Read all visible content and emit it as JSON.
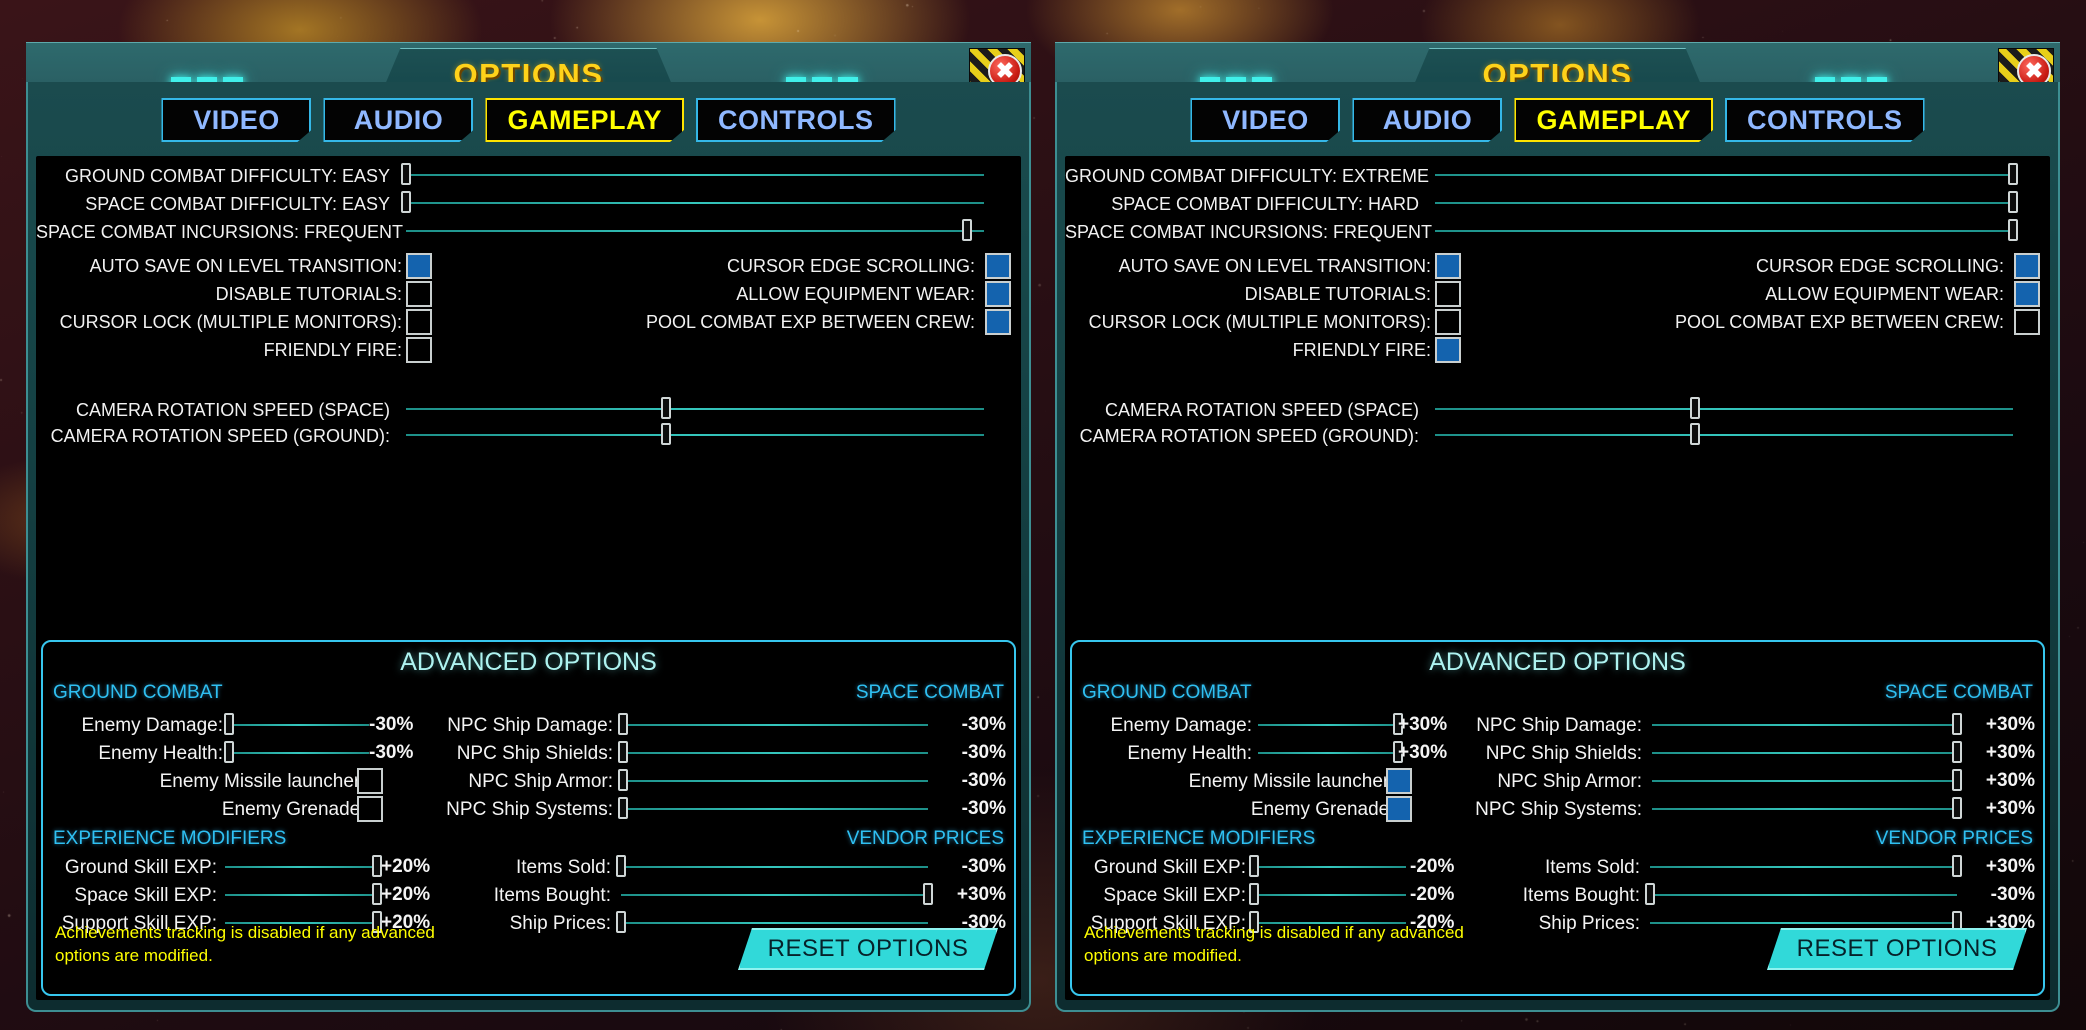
{
  "window": {
    "title": "OPTIONS",
    "close_icon": "close-x-icon",
    "dots_icon": "three-dash-icon"
  },
  "tabs": [
    {
      "label": "VIDEO",
      "active": false
    },
    {
      "label": "AUDIO",
      "active": false
    },
    {
      "label": "GAMEPLAY",
      "active": true
    },
    {
      "label": "CONTROLS",
      "active": false
    }
  ],
  "advanced": {
    "title": "ADVANCED OPTIONS",
    "ground_combat_header": "GROUND COMBAT",
    "space_combat_header": "SPACE COMBAT",
    "experience_header": "EXPERIENCE MODIFIERS",
    "vendor_header": "VENDOR PRICES",
    "note": "Achievements tracking is disabled if any advanced options are modified.",
    "reset_label": "RESET OPTIONS"
  },
  "colors": {
    "accent_cyan": "#37c6ee",
    "title_yellow": "#ffd21a",
    "tab_active": "#ffff00",
    "tab_inactive": "#8fb8ff",
    "checkbox_on": "#1463ae",
    "slider_track": "#35c6bd",
    "reset_button": "#31d9d9",
    "warning_yellow": "#ffff00",
    "panel_teal": "#2e6a6d"
  },
  "panels": [
    {
      "id": "left-panel",
      "basic": [
        {
          "name": "ground-combat-difficulty",
          "label": "GROUND COMBAT DIFFICULTY: EASY",
          "type": "slider",
          "value": 0
        },
        {
          "name": "space-combat-difficulty",
          "label": "SPACE COMBAT DIFFICULTY: EASY",
          "type": "slider",
          "value": 0
        },
        {
          "name": "space-combat-incursions",
          "label": "SPACE COMBAT INCURSIONS: FREQUENT",
          "type": "slider",
          "value": 97
        },
        {
          "name": "auto-save-on-level-transition",
          "label": "AUTO SAVE ON LEVEL TRANSITION:",
          "type": "checkbox",
          "checked": true
        },
        {
          "name": "disable-tutorials",
          "label": "DISABLE TUTORIALS:",
          "type": "checkbox",
          "checked": false
        },
        {
          "name": "cursor-lock-multiple-monitors",
          "label": "CURSOR LOCK (MULTIPLE MONITORS):",
          "type": "checkbox",
          "checked": false
        },
        {
          "name": "friendly-fire",
          "label": "FRIENDLY FIRE:",
          "type": "checkbox",
          "checked": false
        },
        {
          "name": "cursor-edge-scrolling",
          "label": "CURSOR EDGE SCROLLING:",
          "type": "checkbox",
          "checked": true
        },
        {
          "name": "allow-equipment-wear",
          "label": "ALLOW EQUIPMENT WEAR:",
          "type": "checkbox",
          "checked": true
        },
        {
          "name": "pool-combat-exp-between-crew",
          "label": "POOL COMBAT EXP BETWEEN CREW:",
          "type": "checkbox",
          "checked": true
        },
        {
          "name": "camera-rotation-speed-space",
          "label": "CAMERA ROTATION SPEED (SPACE)",
          "type": "slider",
          "value": 45
        },
        {
          "name": "camera-rotation-speed-ground",
          "label": "CAMERA ROTATION SPEED (GROUND):",
          "type": "slider",
          "value": 45
        }
      ],
      "ground_combat": [
        {
          "name": "enemy-damage",
          "label": "Enemy Damage:",
          "type": "slider",
          "value": 0,
          "pct": "-30%"
        },
        {
          "name": "enemy-health",
          "label": "Enemy Health:",
          "type": "slider",
          "value": 0,
          "pct": "-30%"
        },
        {
          "name": "enemy-missile-launchers",
          "label": "Enemy Missile launchers:",
          "type": "checkbox",
          "checked": false
        },
        {
          "name": "enemy-grenades",
          "label": "Enemy Grenades:",
          "type": "checkbox",
          "checked": false
        }
      ],
      "space_combat": [
        {
          "name": "npc-ship-damage",
          "label": "NPC Ship Damage:",
          "type": "slider",
          "value": 0,
          "pct": "-30%"
        },
        {
          "name": "npc-ship-shields",
          "label": "NPC Ship Shields:",
          "type": "slider",
          "value": 0,
          "pct": "-30%"
        },
        {
          "name": "npc-ship-armor",
          "label": "NPC Ship Armor:",
          "type": "slider",
          "value": 0,
          "pct": "-30%"
        },
        {
          "name": "npc-ship-systems",
          "label": "NPC Ship Systems:",
          "type": "slider",
          "value": 0,
          "pct": "-30%"
        }
      ],
      "experience": [
        {
          "name": "ground-skill-exp",
          "label": "Ground Skill EXP:",
          "type": "slider",
          "value": 100,
          "pct": "+20%"
        },
        {
          "name": "space-skill-exp",
          "label": "Space Skill EXP:",
          "type": "slider",
          "value": 100,
          "pct": "+20%"
        },
        {
          "name": "support-skill-exp",
          "label": "Support Skill EXP:",
          "type": "slider",
          "value": 100,
          "pct": "+20%"
        }
      ],
      "vendor": [
        {
          "name": "items-sold",
          "label": "Items Sold:",
          "type": "slider",
          "value": 0,
          "pct": "-30%"
        },
        {
          "name": "items-bought",
          "label": "Items Bought:",
          "type": "slider",
          "value": 100,
          "pct": "+30%"
        },
        {
          "name": "ship-prices",
          "label": "Ship Prices:",
          "type": "slider",
          "value": 0,
          "pct": "-30%"
        }
      ]
    },
    {
      "id": "right-panel",
      "basic": [
        {
          "name": "ground-combat-difficulty",
          "label": "GROUND COMBAT DIFFICULTY: EXTREME",
          "type": "slider",
          "value": 100
        },
        {
          "name": "space-combat-difficulty",
          "label": "SPACE COMBAT DIFFICULTY: HARD",
          "type": "slider",
          "value": 100
        },
        {
          "name": "space-combat-incursions",
          "label": "SPACE COMBAT INCURSIONS: FREQUENT",
          "type": "slider",
          "value": 100
        },
        {
          "name": "auto-save-on-level-transition",
          "label": "AUTO SAVE ON LEVEL TRANSITION:",
          "type": "checkbox",
          "checked": true
        },
        {
          "name": "disable-tutorials",
          "label": "DISABLE TUTORIALS:",
          "type": "checkbox",
          "checked": false
        },
        {
          "name": "cursor-lock-multiple-monitors",
          "label": "CURSOR LOCK (MULTIPLE MONITORS):",
          "type": "checkbox",
          "checked": false
        },
        {
          "name": "friendly-fire",
          "label": "FRIENDLY FIRE:",
          "type": "checkbox",
          "checked": true
        },
        {
          "name": "cursor-edge-scrolling",
          "label": "CURSOR EDGE SCROLLING:",
          "type": "checkbox",
          "checked": true
        },
        {
          "name": "allow-equipment-wear",
          "label": "ALLOW EQUIPMENT WEAR:",
          "type": "checkbox",
          "checked": true
        },
        {
          "name": "pool-combat-exp-between-crew",
          "label": "POOL COMBAT EXP BETWEEN CREW:",
          "type": "checkbox",
          "checked": false
        },
        {
          "name": "camera-rotation-speed-space",
          "label": "CAMERA ROTATION SPEED (SPACE)",
          "type": "slider",
          "value": 45
        },
        {
          "name": "camera-rotation-speed-ground",
          "label": "CAMERA ROTATION SPEED (GROUND):",
          "type": "slider",
          "value": 45
        }
      ],
      "ground_combat": [
        {
          "name": "enemy-damage",
          "label": "Enemy Damage:",
          "type": "slider",
          "value": 100,
          "pct": "+30%"
        },
        {
          "name": "enemy-health",
          "label": "Enemy Health:",
          "type": "slider",
          "value": 100,
          "pct": "+30%"
        },
        {
          "name": "enemy-missile-launchers",
          "label": "Enemy Missile launchers:",
          "type": "checkbox",
          "checked": true
        },
        {
          "name": "enemy-grenades",
          "label": "Enemy Grenades:",
          "type": "checkbox",
          "checked": true
        }
      ],
      "space_combat": [
        {
          "name": "npc-ship-damage",
          "label": "NPC Ship Damage:",
          "type": "slider",
          "value": 100,
          "pct": "+30%"
        },
        {
          "name": "npc-ship-shields",
          "label": "NPC Ship Shields:",
          "type": "slider",
          "value": 100,
          "pct": "+30%"
        },
        {
          "name": "npc-ship-armor",
          "label": "NPC Ship Armor:",
          "type": "slider",
          "value": 100,
          "pct": "+30%"
        },
        {
          "name": "npc-ship-systems",
          "label": "NPC Ship Systems:",
          "type": "slider",
          "value": 100,
          "pct": "+30%"
        }
      ],
      "experience": [
        {
          "name": "ground-skill-exp",
          "label": "Ground Skill EXP:",
          "type": "slider",
          "value": 0,
          "pct": "-20%"
        },
        {
          "name": "space-skill-exp",
          "label": "Space Skill EXP:",
          "type": "slider",
          "value": 0,
          "pct": "-20%"
        },
        {
          "name": "support-skill-exp",
          "label": "Support Skill EXP:",
          "type": "slider",
          "value": 0,
          "pct": "-20%"
        }
      ],
      "vendor": [
        {
          "name": "items-sold",
          "label": "Items Sold:",
          "type": "slider",
          "value": 100,
          "pct": "+30%"
        },
        {
          "name": "items-bought",
          "label": "Items Bought:",
          "type": "slider",
          "value": 0,
          "pct": "-30%"
        },
        {
          "name": "ship-prices",
          "label": "Ship Prices:",
          "type": "slider",
          "value": 100,
          "pct": "+30%"
        }
      ]
    }
  ]
}
